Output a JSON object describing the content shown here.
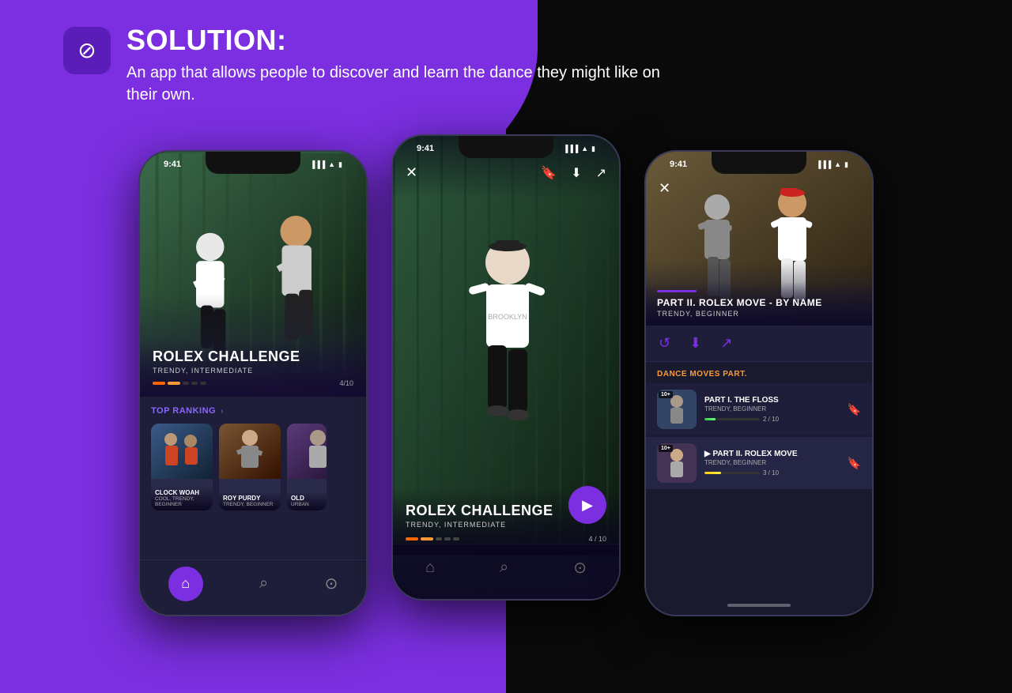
{
  "background": {
    "left_color": "#7B2FE0",
    "right_color": "#0a0a0a"
  },
  "header": {
    "title": "SOLUTION:",
    "description": "An app that allows people to discover and learn the dance they might like on their own.",
    "logo_symbol": "⊘"
  },
  "phone1": {
    "status_time": "9:41",
    "dance_title": "ROLEX CHALLENGE",
    "dance_tags": "TRENDY, INTERMEDIATE",
    "progress_label": "4/10",
    "ranking_title": "TOP RANKING",
    "ranking_arrow": "›",
    "cards": [
      {
        "title": "CLOCK WOAH",
        "sub": "COOL, TRENDY, BEGINNER"
      },
      {
        "title": "ROY PURDY",
        "sub": "TRENDY, BEGINNER"
      },
      {
        "title": "OLD",
        "sub": "URBAN"
      }
    ],
    "nav_home": "⌂",
    "nav_search": "⌕",
    "nav_profile": "⊙"
  },
  "phone2": {
    "status_time": "9:41",
    "close_icon": "✕",
    "bookmark_icon": "⊟",
    "download_icon": "⬇",
    "share_icon": "⬡",
    "dance_title": "ROLEX CHALLENGE",
    "dance_tags": "TRENDY, INTERMEDIATE",
    "progress_label": "4 / 10",
    "play_icon": "▶"
  },
  "phone3": {
    "status_time": "9:41",
    "close_icon": "✕",
    "hero_title": "PART II. ROLEX MOVE - BY NAME",
    "hero_tags": "TRENDY, BEGINNER",
    "action_replay": "↺",
    "action_download": "⬇",
    "action_share": "⬡",
    "section_label": "DANCE MOVES PART.",
    "parts": [
      {
        "title": "PART I. THE FLOSS",
        "subtitle": "TRENDY, BEGINNER",
        "progress": "2 / 10",
        "badge": "10+"
      },
      {
        "title": "▶ PART II. ROLEX MOVE",
        "subtitle": "TRENDY, BEGINNER",
        "progress": "3 / 10",
        "badge": "10+"
      }
    ]
  }
}
